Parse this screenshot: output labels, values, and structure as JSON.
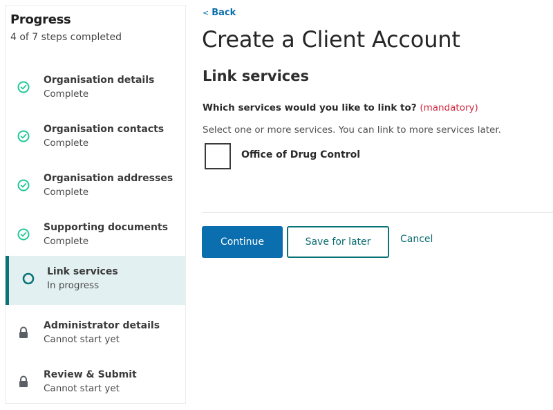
{
  "sidebar": {
    "title": "Progress",
    "subtitle": "4 of 7 steps completed",
    "steps": [
      {
        "label": "Organisation details",
        "status": "Complete",
        "state": "complete"
      },
      {
        "label": "Organisation contacts",
        "status": "Complete",
        "state": "complete"
      },
      {
        "label": "Organisation addresses",
        "status": "Complete",
        "state": "complete"
      },
      {
        "label": "Supporting documents",
        "status": "Complete",
        "state": "complete"
      },
      {
        "label": "Link services",
        "status": "In progress",
        "state": "active"
      },
      {
        "label": "Administrator details",
        "status": "Cannot start yet",
        "state": "locked"
      },
      {
        "label": "Review & Submit",
        "status": "Cannot start yet",
        "state": "locked"
      }
    ]
  },
  "main": {
    "back_chevron": "<",
    "back_label": "Back",
    "page_title": "Create a Client Account",
    "section_title": "Link services",
    "question": "Which services would you like to link to?",
    "mandatory": "(mandatory)",
    "hint": "Select one or more services. You can link to more services later.",
    "services": [
      {
        "label": "Office of Drug Control",
        "checked": false
      }
    ],
    "buttons": {
      "continue": "Continue",
      "save_for_later": "Save for later",
      "cancel": "Cancel"
    }
  },
  "colors": {
    "complete": "#20c997",
    "active_accent": "#0a7377",
    "active_bg": "#e3f0f2",
    "primary": "#0b6eae",
    "mandatory": "#d3273e",
    "locked": "#5a5f66"
  }
}
